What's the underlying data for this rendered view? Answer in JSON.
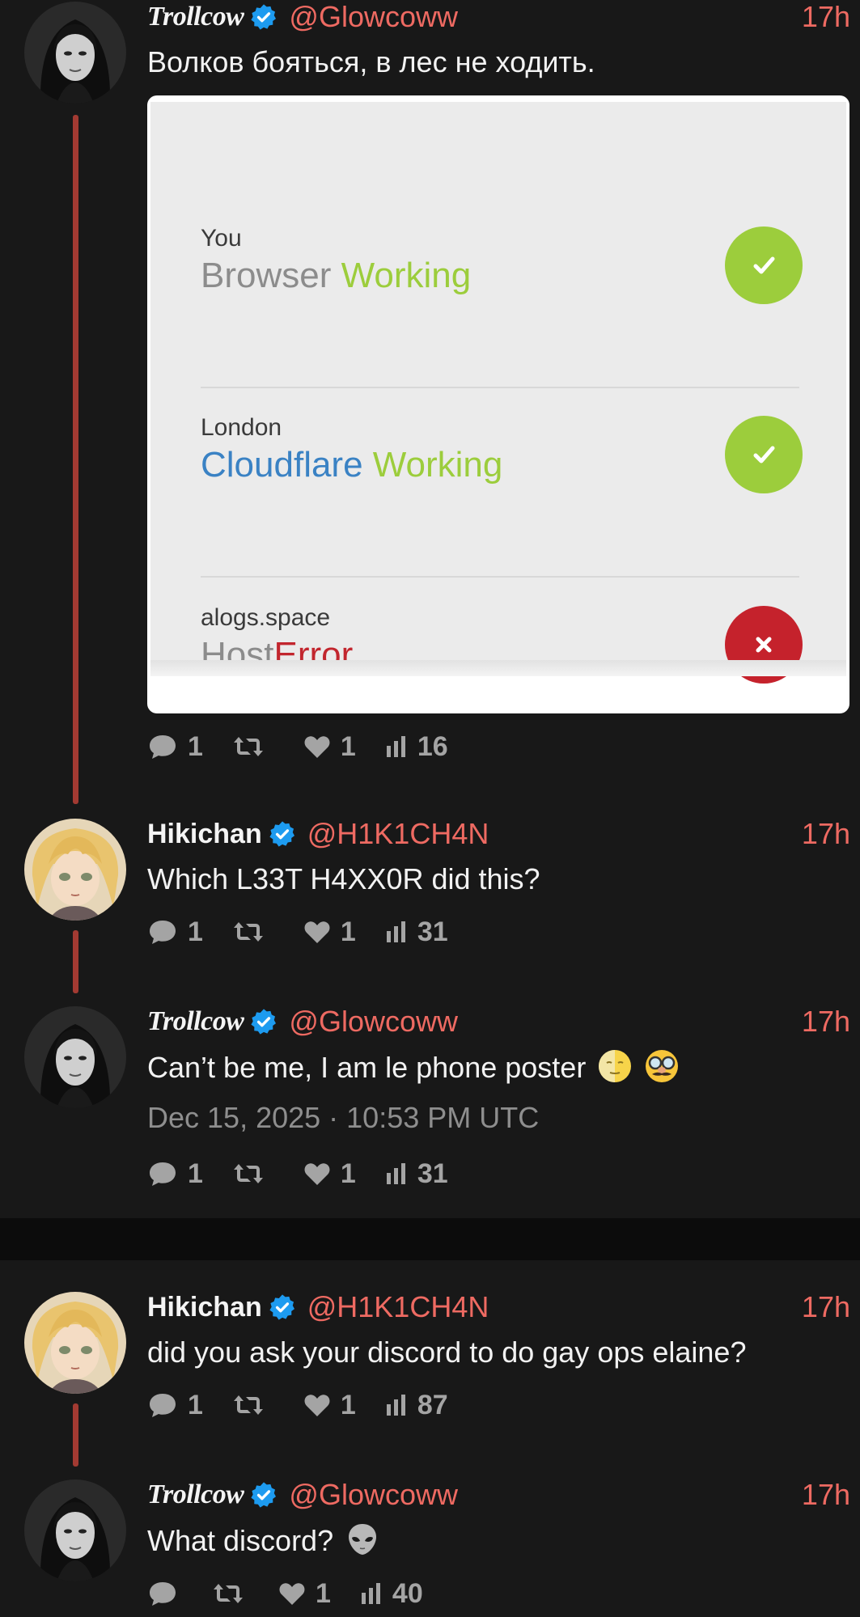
{
  "tweets": [
    {
      "name": "Trollcow",
      "handle": "@Glowcoww",
      "time": "17h",
      "text": "Волков бояться,  в лес не ходить.",
      "replies": "1",
      "retweets": "",
      "likes": "1",
      "views": "16"
    },
    {
      "name": "Hikichan",
      "handle": "@H1K1CH4N",
      "time": "17h",
      "text": "Which L33T H4XX0R did this?",
      "replies": "1",
      "retweets": "",
      "likes": "1",
      "views": "31"
    },
    {
      "name": "Trollcow",
      "handle": "@Glowcoww",
      "time": "17h",
      "text": "Can’t be me, I am le phone poster",
      "date": "Dec 15, 2025 · 10:53 PM UTC",
      "replies": "1",
      "retweets": "",
      "likes": "1",
      "views": "31"
    },
    {
      "name": "Hikichan",
      "handle": "@H1K1CH4N",
      "time": "17h",
      "text": "did  you ask your discord to do gay ops elaine?",
      "replies": "1",
      "retweets": "",
      "likes": "1",
      "views": "87"
    },
    {
      "name": "Trollcow",
      "handle": "@Glowcoww",
      "time": "17h",
      "text": "What discord?",
      "replies": "",
      "retweets": "",
      "likes": "1",
      "views": "40"
    }
  ],
  "card": {
    "rows": [
      {
        "sub": "You",
        "word1": "Browser",
        "word2": "Working",
        "status": "ok"
      },
      {
        "sub": "London",
        "word1": "Cloudflare",
        "word2": "Working",
        "status": "ok"
      },
      {
        "sub": "alogs.space",
        "word1": "Host",
        "word2": "Error",
        "status": "error"
      }
    ]
  },
  "icons": {
    "verified": "verified-badge-icon",
    "reply": "comment-icon",
    "retweet": "retweet-icon",
    "like": "heart-icon",
    "views": "bar-chart-icon",
    "emoji_1": "moon-face-emoji",
    "emoji_2": "disguised-face-emoji",
    "emoji_3": "alien-emoji"
  },
  "colors": {
    "accent": "#ee6a62",
    "thread_line": "#a23a32",
    "verified": "#1d9bf0",
    "ok_green": "#9ccd3c",
    "error_red": "#c5222c",
    "cloudflare_blue": "#3a82c4"
  }
}
